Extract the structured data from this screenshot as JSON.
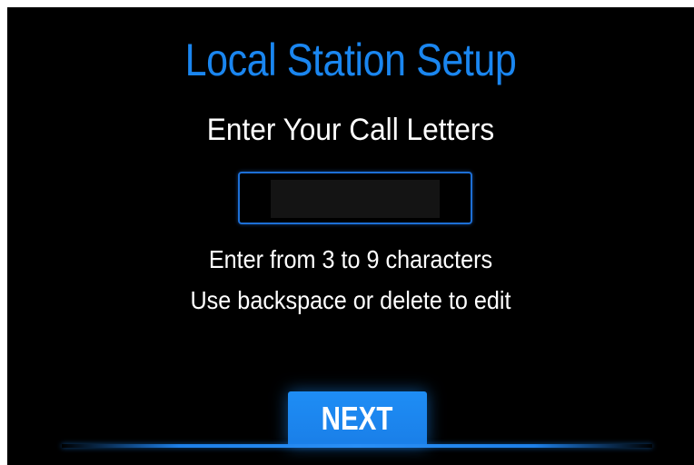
{
  "screen": {
    "title": "Local Station Setup",
    "subtitle": "Enter Your Call Letters",
    "call_letters_input": {
      "value": "",
      "placeholder": ""
    },
    "hints": [
      "Enter from 3 to 9 characters",
      "Use backspace or delete to edit"
    ],
    "next_label": "NEXT"
  },
  "colors": {
    "background": "#000000",
    "title": "#1a86f0",
    "accent": "#1e8df5",
    "text": "#ffffff"
  }
}
